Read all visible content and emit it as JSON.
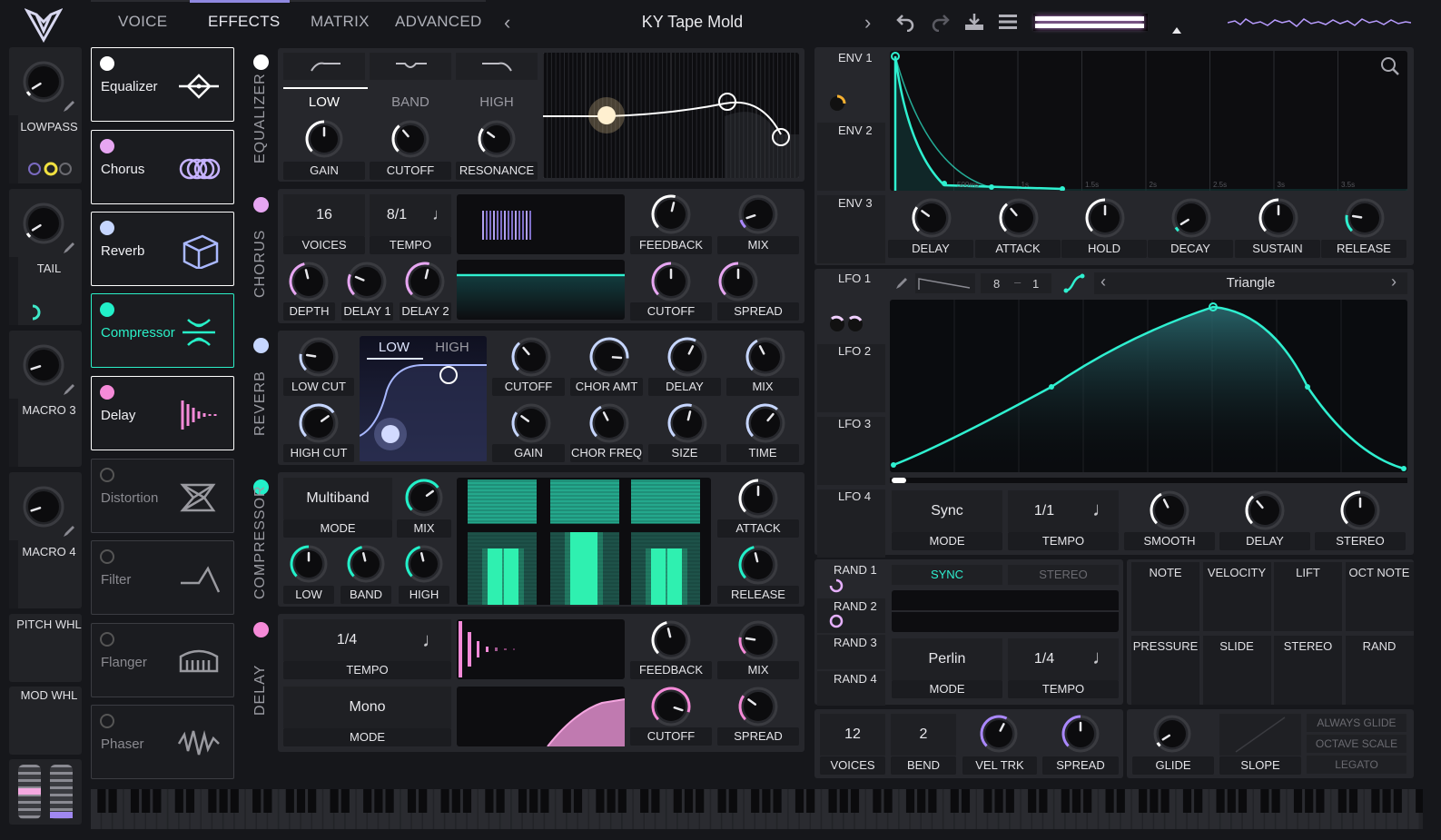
{
  "header": {
    "tabs": [
      "VOICE",
      "EFFECTS",
      "MATRIX",
      "ADVANCED"
    ],
    "active_tab": "EFFECTS",
    "preset_name": "KY Tape Mold"
  },
  "macros": {
    "m1": "LOWPASS",
    "m2": "TAIL",
    "m3": "MACRO 3",
    "m4": "MACRO 4",
    "pitch_wheel": "PITCH WHL",
    "mod_wheel": "MOD WHL"
  },
  "effects": [
    {
      "name": "Equalizer",
      "enabled": true,
      "led": "#ffffff",
      "color": "#ffffff"
    },
    {
      "name": "Chorus",
      "enabled": true,
      "led": "#e7a6f2",
      "color": "#c7b0ff"
    },
    {
      "name": "Reverb",
      "enabled": true,
      "led": "#c6d6ff",
      "color": "#aab8ff"
    },
    {
      "name": "Compressor",
      "enabled": true,
      "led": "#22f0c9",
      "color": "#27f0c8"
    },
    {
      "name": "Delay",
      "enabled": true,
      "led": "#f58ad8",
      "color": "#f58ad8"
    },
    {
      "name": "Distortion",
      "enabled": false,
      "led": "#555",
      "color": "#9a9aa0"
    },
    {
      "name": "Filter",
      "enabled": false,
      "led": "#555",
      "color": "#9a9aa0"
    },
    {
      "name": "Flanger",
      "enabled": false,
      "led": "#555",
      "color": "#9a9aa0"
    },
    {
      "name": "Phaser",
      "enabled": false,
      "led": "#555",
      "color": "#9a9aa0"
    }
  ],
  "section_titles": {
    "eq": "EQUALIZER",
    "chorus": "CHORUS",
    "reverb": "REVERB",
    "compressor": "COMPRESSOR",
    "delay": "DELAY"
  },
  "eq": {
    "bands": [
      "LOW",
      "BAND",
      "HIGH"
    ],
    "knobs": [
      "GAIN",
      "CUTOFF",
      "RESONANCE"
    ]
  },
  "chorus": {
    "voices": "16",
    "voices_label": "VOICES",
    "tempo": "8/1",
    "tempo_label": "TEMPO",
    "knobs_top": [
      "FEEDBACK",
      "MIX"
    ],
    "knobs_bottom": [
      "DEPTH",
      "DELAY 1",
      "DELAY 2",
      "CUTOFF",
      "SPREAD"
    ]
  },
  "reverb": {
    "tabs": [
      "LOW",
      "HIGH"
    ],
    "knobs_left": [
      "LOW CUT",
      "HIGH CUT"
    ],
    "knobs_top": [
      "CUTOFF",
      "CHOR AMT",
      "DELAY",
      "MIX"
    ],
    "knobs_bottom": [
      "GAIN",
      "CHOR FREQ",
      "SIZE",
      "TIME"
    ]
  },
  "compressor": {
    "mode": "Multiband",
    "mode_label": "MODE",
    "knobs": [
      "MIX",
      "LOW",
      "BAND",
      "HIGH",
      "ATTACK",
      "RELEASE"
    ]
  },
  "delay": {
    "tempo": "1/4",
    "tempo_label": "TEMPO",
    "mode": "Mono",
    "mode_label": "MODE",
    "knobs": [
      "FEEDBACK",
      "MIX",
      "CUTOFF",
      "SPREAD"
    ]
  },
  "envelopes": {
    "rows": [
      "ENV 1",
      "ENV 2",
      "ENV 3"
    ],
    "knobs": [
      "DELAY",
      "ATTACK",
      "HOLD",
      "DECAY",
      "SUSTAIN",
      "RELEASE"
    ],
    "time_ticks": [
      "500ms",
      "1s",
      "1.5s",
      "2s",
      "2.5s",
      "3s",
      "3.5s"
    ]
  },
  "lfos": {
    "rows": [
      "LFO 1",
      "LFO 2",
      "LFO 3",
      "LFO 4"
    ],
    "grid_x": "8",
    "grid_y": "1",
    "shape": "Triangle",
    "mode": "Sync",
    "mode_label": "MODE",
    "tempo": "1/1",
    "tempo_label": "TEMPO",
    "knobs": [
      "SMOOTH",
      "DELAY",
      "STEREO"
    ]
  },
  "randoms": {
    "rows": [
      "RAND 1",
      "RAND 2",
      "RAND 3",
      "RAND 4"
    ],
    "sync": "SYNC",
    "stereo": "STEREO",
    "mode": "Perlin",
    "mode_label": "MODE",
    "tempo": "1/4",
    "tempo_label": "TEMPO"
  },
  "mod_sources": [
    "NOTE",
    "VELOCITY",
    "LIFT",
    "OCT NOTE",
    "PRESSURE",
    "SLIDE",
    "STEREO",
    "RAND"
  ],
  "voice": {
    "voices": "12",
    "voices_label": "VOICES",
    "bend": "2",
    "bend_label": "BEND",
    "vel_trk": "VEL TRK",
    "spread": "SPREAD",
    "glide": "GLIDE",
    "slope": "SLOPE",
    "always_glide": "ALWAYS GLIDE",
    "octave_scale": "OCTAVE SCALE",
    "legato": "LEGATO"
  },
  "colors": {
    "accent_teal": "#2ff0d0",
    "accent_pink": "#f58ad8",
    "accent_purple": "#aa88ff"
  }
}
